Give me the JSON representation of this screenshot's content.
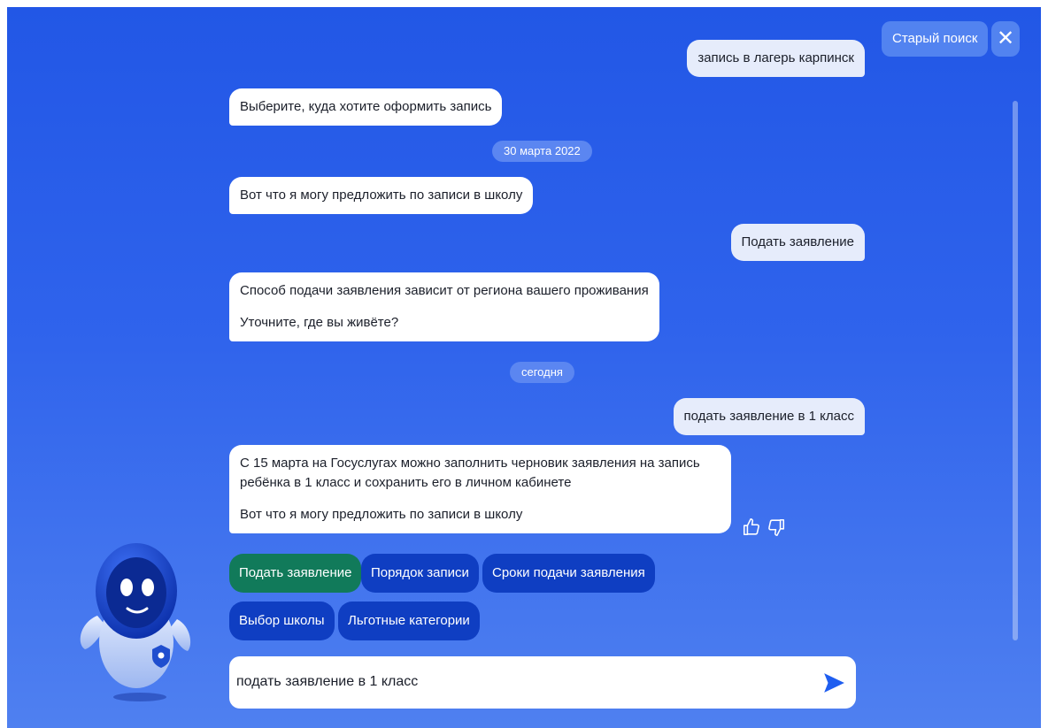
{
  "header": {
    "old_search_label": "Старый поиск",
    "close_label": "✕"
  },
  "messages": {
    "user_1": "запись в лагерь карпинск",
    "bot_1": "Выберите, куда хотите оформить запись",
    "date_1": "30 марта 2022",
    "bot_2": "Вот что я могу предложить по записи в школу",
    "user_2": "Подать заявление",
    "bot_3": {
      "line_1": "Способ подачи заявления зависит от региона вашего проживания",
      "line_2": "Уточните, где вы живёте?"
    },
    "date_2": "сегодня",
    "user_3": "подать заявление в 1 класс",
    "bot_4": {
      "line_1": "С 15 марта на Госуслугах можно заполнить черновик заявления на запись",
      "line_2": "ребёнка в 1 класс и сохранить его в личном кабинете",
      "line_3": "Вот что я могу предложить по записи в школу"
    }
  },
  "chips": [
    {
      "label": "Подать заявление",
      "active": true
    },
    {
      "label": "Порядок записи"
    },
    {
      "label": "Сроки подачи заявления"
    },
    {
      "label": "Выбор школы"
    },
    {
      "label": "Льготные категории"
    }
  ],
  "input": {
    "value": "подать заявление в 1 класс"
  },
  "icons": {
    "like": "thumbs-up-icon",
    "dislike": "thumbs-down-icon",
    "send": "send-arrow-icon",
    "close": "close-icon",
    "mascot": "robot-mascot"
  },
  "colors": {
    "background": "#2f63ec",
    "chip": "#0f3ec2",
    "chip_active": "#117a5a",
    "send": "#1f5ef0"
  }
}
